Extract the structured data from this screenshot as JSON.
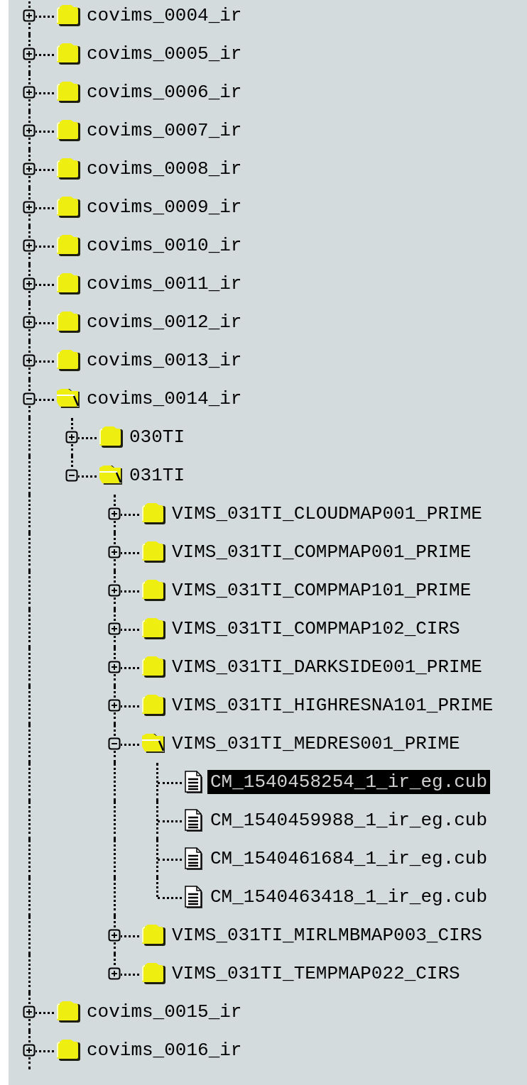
{
  "tree": [
    {
      "label": "covims_0004_ir",
      "kind": "folder",
      "expanded": false,
      "selected": false
    },
    {
      "label": "covims_0005_ir",
      "kind": "folder",
      "expanded": false,
      "selected": false
    },
    {
      "label": "covims_0006_ir",
      "kind": "folder",
      "expanded": false,
      "selected": false
    },
    {
      "label": "covims_0007_ir",
      "kind": "folder",
      "expanded": false,
      "selected": false
    },
    {
      "label": "covims_0008_ir",
      "kind": "folder",
      "expanded": false,
      "selected": false
    },
    {
      "label": "covims_0009_ir",
      "kind": "folder",
      "expanded": false,
      "selected": false
    },
    {
      "label": "covims_0010_ir",
      "kind": "folder",
      "expanded": false,
      "selected": false
    },
    {
      "label": "covims_0011_ir",
      "kind": "folder",
      "expanded": false,
      "selected": false
    },
    {
      "label": "covims_0012_ir",
      "kind": "folder",
      "expanded": false,
      "selected": false
    },
    {
      "label": "covims_0013_ir",
      "kind": "folder",
      "expanded": false,
      "selected": false
    },
    {
      "label": "covims_0014_ir",
      "kind": "folder",
      "expanded": true,
      "selected": false,
      "children": [
        {
          "label": "030TI",
          "kind": "folder",
          "expanded": false,
          "selected": false
        },
        {
          "label": "031TI",
          "kind": "folder",
          "expanded": true,
          "selected": false,
          "children": [
            {
              "label": "VIMS_031TI_CLOUDMAP001_PRIME",
              "kind": "folder",
              "expanded": false,
              "selected": false
            },
            {
              "label": "VIMS_031TI_COMPMAP001_PRIME",
              "kind": "folder",
              "expanded": false,
              "selected": false
            },
            {
              "label": "VIMS_031TI_COMPMAP101_PRIME",
              "kind": "folder",
              "expanded": false,
              "selected": false
            },
            {
              "label": "VIMS_031TI_COMPMAP102_CIRS",
              "kind": "folder",
              "expanded": false,
              "selected": false
            },
            {
              "label": "VIMS_031TI_DARKSIDE001_PRIME",
              "kind": "folder",
              "expanded": false,
              "selected": false
            },
            {
              "label": "VIMS_031TI_HIGHRESNA101_PRIME",
              "kind": "folder",
              "expanded": false,
              "selected": false
            },
            {
              "label": "VIMS_031TI_MEDRES001_PRIME",
              "kind": "folder",
              "expanded": true,
              "selected": false,
              "children": [
                {
                  "label": "CM_1540458254_1_ir_eg.cub",
                  "kind": "file",
                  "selected": true
                },
                {
                  "label": "CM_1540459988_1_ir_eg.cub",
                  "kind": "file",
                  "selected": false
                },
                {
                  "label": "CM_1540461684_1_ir_eg.cub",
                  "kind": "file",
                  "selected": false
                },
                {
                  "label": "CM_1540463418_1_ir_eg.cub",
                  "kind": "file",
                  "selected": false
                }
              ]
            },
            {
              "label": "VIMS_031TI_MIRLMBMAP003_CIRS",
              "kind": "folder",
              "expanded": false,
              "selected": false
            },
            {
              "label": "VIMS_031TI_TEMPMAP022_CIRS",
              "kind": "folder",
              "expanded": false,
              "selected": false
            }
          ]
        }
      ]
    },
    {
      "label": "covims_0015_ir",
      "kind": "folder",
      "expanded": false,
      "selected": false
    },
    {
      "label": "covims_0016_ir",
      "kind": "folder",
      "expanded": false,
      "selected": false
    }
  ]
}
